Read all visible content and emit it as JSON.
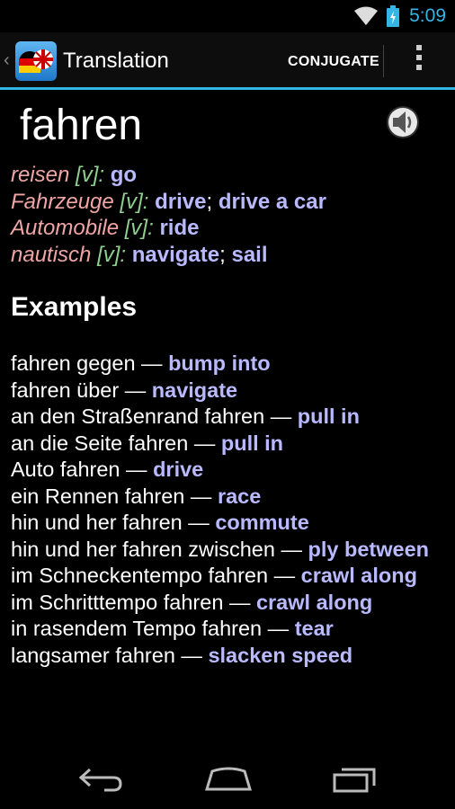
{
  "status_bar": {
    "time": "5:09",
    "wifi_icon": "wifi-icon",
    "battery_icon": "battery-charging-icon"
  },
  "action_bar": {
    "title": "Translation",
    "conjugate_label": "CONJUGATE",
    "app_icon": "de-en-flags-icon",
    "overflow_icon": "overflow-menu-icon"
  },
  "entry": {
    "headword": "fahren",
    "speaker_icon": "speaker-icon",
    "senses": [
      {
        "context": "reisen",
        "pos": "[v]:",
        "translations": [
          "go"
        ]
      },
      {
        "context": "Fahrzeuge",
        "pos": "[v]:",
        "translations": [
          "drive",
          "drive a car"
        ]
      },
      {
        "context": "Automobile",
        "pos": "[v]:",
        "translations": [
          "ride"
        ]
      },
      {
        "context": "nautisch",
        "pos": "[v]:",
        "translations": [
          "navigate",
          "sail"
        ]
      }
    ]
  },
  "examples": {
    "heading": "Examples",
    "dash": "—",
    "items": [
      {
        "de": "fahren gegen",
        "en": "bump into"
      },
      {
        "de": "fahren über",
        "en": "navigate"
      },
      {
        "de": "an den Straßenrand fahren",
        "en": "pull in"
      },
      {
        "de": "an die Seite fahren",
        "en": "pull in"
      },
      {
        "de": "Auto fahren",
        "en": "drive"
      },
      {
        "de": "ein Rennen fahren",
        "en": "race"
      },
      {
        "de": "hin und her fahren",
        "en": "commute"
      },
      {
        "de": "hin und her fahren zwischen",
        "en": "ply between"
      },
      {
        "de": "im Schneckentempo fahren",
        "en": "crawl along"
      },
      {
        "de": "im Schritttempo fahren",
        "en": "crawl along"
      },
      {
        "de": "in rasendem Tempo fahren",
        "en": "tear"
      },
      {
        "de": "langsamer fahren",
        "en": "slacken speed"
      }
    ]
  },
  "nav_bar": {
    "back_icon": "back-icon",
    "home_icon": "home-icon",
    "recents_icon": "recent-apps-icon"
  },
  "colors": {
    "accent": "#33b5e5",
    "context": "#f0a5a5",
    "pos": "#8fcf8f",
    "translation": "#b9b9ff"
  }
}
